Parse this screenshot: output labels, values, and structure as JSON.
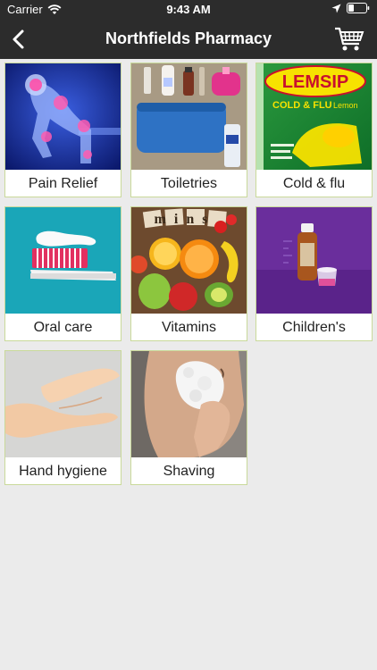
{
  "status_bar": {
    "carrier": "Carrier",
    "time": "9:43 AM"
  },
  "header": {
    "title": "Northfields Pharmacy"
  },
  "categories": [
    {
      "label": "Pain Relief"
    },
    {
      "label": "Toiletries"
    },
    {
      "label": "Cold & flu"
    },
    {
      "label": "Oral care"
    },
    {
      "label": "Vitamins"
    },
    {
      "label": "Children's"
    },
    {
      "label": "Hand hygiene"
    },
    {
      "label": "Shaving"
    }
  ],
  "image_text": {
    "lemsip_brand": "LEMSIP",
    "lemsip_sub": "COLD & FLU",
    "lemsip_flavour": "Lemon",
    "vitamins_letters": "mins"
  },
  "colors": {
    "bar": "#2c2c2c",
    "tile_border": "#c9d99a",
    "background": "#ebebeb"
  }
}
